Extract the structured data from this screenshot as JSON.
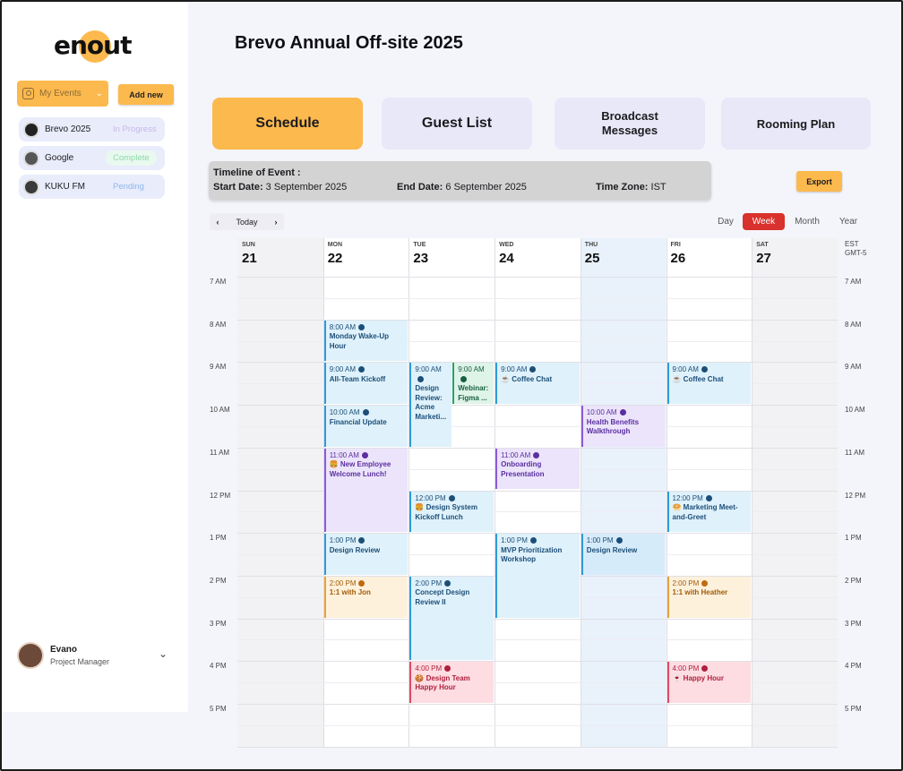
{
  "app": {
    "logo_text": "enout",
    "page_title": "Brevo Annual Off-site 2025"
  },
  "sidebar": {
    "my_events_label": "My Events",
    "add_new_label": "Add new",
    "events": [
      {
        "name": "Brevo 2025",
        "status": "In Progress"
      },
      {
        "name": "Google",
        "status": "Complete"
      },
      {
        "name": "KUKU FM",
        "status": "Pending"
      }
    ],
    "user": {
      "name": "Evano",
      "role": "Project Manager"
    }
  },
  "tabs": {
    "schedule": "Schedule",
    "guest_list": "Guest List",
    "broadcast_line1": "Broadcast",
    "broadcast_line2": "Messages",
    "rooming": "Rooming Plan"
  },
  "timeline": {
    "title": "Timeline of Event :",
    "start_label": "Start Date:",
    "start_value": " 3 September 2025",
    "end_label": "End Date:",
    "end_value": " 6 September 2025",
    "tz_label": "Time Zone:",
    "tz_value": " IST"
  },
  "export_label": "Export",
  "calendar": {
    "today_label": "Today",
    "views": [
      "Day",
      "Week",
      "Month",
      "Year"
    ],
    "active_view": "Week",
    "timezone_line1": "EST",
    "timezone_line2": "GMT-5",
    "days": [
      {
        "dow": "SUN",
        "num": "21"
      },
      {
        "dow": "MON",
        "num": "22"
      },
      {
        "dow": "TUE",
        "num": "23"
      },
      {
        "dow": "WED",
        "num": "24"
      },
      {
        "dow": "THU",
        "num": "25"
      },
      {
        "dow": "FRI",
        "num": "26"
      },
      {
        "dow": "SAT",
        "num": "27"
      }
    ],
    "hours": [
      "7 AM",
      "8 AM",
      "9 AM",
      "10 AM",
      "11 AM",
      "12 PM",
      "1 PM",
      "2 PM",
      "3 PM",
      "4 PM",
      "5 PM"
    ],
    "events": [
      {
        "day": 1,
        "start": 8,
        "dur": 1,
        "color": "blue",
        "time": "8:00 AM",
        "title": "Monday Wake-Up Hour"
      },
      {
        "day": 1,
        "start": 9,
        "dur": 1,
        "color": "blue",
        "time": "9:00 AM",
        "title": "All-Team Kickoff"
      },
      {
        "day": 1,
        "start": 10,
        "dur": 1,
        "color": "blue",
        "time": "10:00 AM",
        "title": "Financial Update"
      },
      {
        "day": 1,
        "start": 11,
        "dur": 2,
        "color": "purple",
        "time": "11:00 AM",
        "title": "🍔 New Employee Welcome Lunch!"
      },
      {
        "day": 1,
        "start": 13,
        "dur": 1,
        "color": "blue",
        "time": "1:00 PM",
        "title": "Design Review"
      },
      {
        "day": 1,
        "start": 14,
        "dur": 1,
        "color": "orange",
        "time": "2:00 PM",
        "title": "1:1 with Jon"
      },
      {
        "day": 2,
        "start": 9,
        "dur": 2,
        "color": "blue",
        "time": "9:00 AM",
        "title": "Design Review: Acme Marketi...",
        "half": "left"
      },
      {
        "day": 2,
        "start": 9,
        "dur": 1,
        "color": "green",
        "time": "9:00 AM",
        "title": "Webinar: Figma ...",
        "half": "right"
      },
      {
        "day": 2,
        "start": 12,
        "dur": 1,
        "color": "blue",
        "time": "12:00 PM",
        "title": "🍔 Design System Kickoff Lunch"
      },
      {
        "day": 2,
        "start": 14,
        "dur": 2,
        "color": "blue",
        "time": "2:00 PM",
        "title": "Concept Design Review II"
      },
      {
        "day": 2,
        "start": 16,
        "dur": 1,
        "color": "red",
        "time": "4:00 PM",
        "title": "🍪 Design Team Happy Hour"
      },
      {
        "day": 3,
        "start": 9,
        "dur": 1,
        "color": "blue",
        "time": "9:00 AM",
        "title": "☕ Coffee Chat"
      },
      {
        "day": 3,
        "start": 11,
        "dur": 1,
        "color": "purple",
        "time": "11:00 AM",
        "title": "Onboarding Presentation"
      },
      {
        "day": 3,
        "start": 13,
        "dur": 2,
        "color": "blue",
        "time": "1:00 PM",
        "title": "MVP Prioritization Workshop"
      },
      {
        "day": 4,
        "start": 10,
        "dur": 1,
        "color": "purple",
        "time": "10:00 AM",
        "title": "Health Benefits Walkthrough"
      },
      {
        "day": 4,
        "start": 13,
        "dur": 1,
        "color": "bluestrong",
        "time": "1:00 PM",
        "title": "Design Review"
      },
      {
        "day": 5,
        "start": 9,
        "dur": 1,
        "color": "blue",
        "time": "9:00 AM",
        "title": "☕ Coffee Chat"
      },
      {
        "day": 5,
        "start": 12,
        "dur": 1,
        "color": "blue",
        "time": "12:00 PM",
        "title": "🥯 Marketing Meet-and-Greet"
      },
      {
        "day": 5,
        "start": 14,
        "dur": 1,
        "color": "orange",
        "time": "2:00 PM",
        "title": "1:1 with Heather"
      },
      {
        "day": 5,
        "start": 16,
        "dur": 1,
        "color": "red",
        "time": "4:00 PM",
        "title": "🍷 Happy Hour"
      }
    ]
  },
  "colors": {
    "accent": "#fcb94d",
    "active_view": "#d9312d",
    "sidebar_item_bg": "#e9ecfb",
    "tab_bg": "#e8e8f8"
  }
}
